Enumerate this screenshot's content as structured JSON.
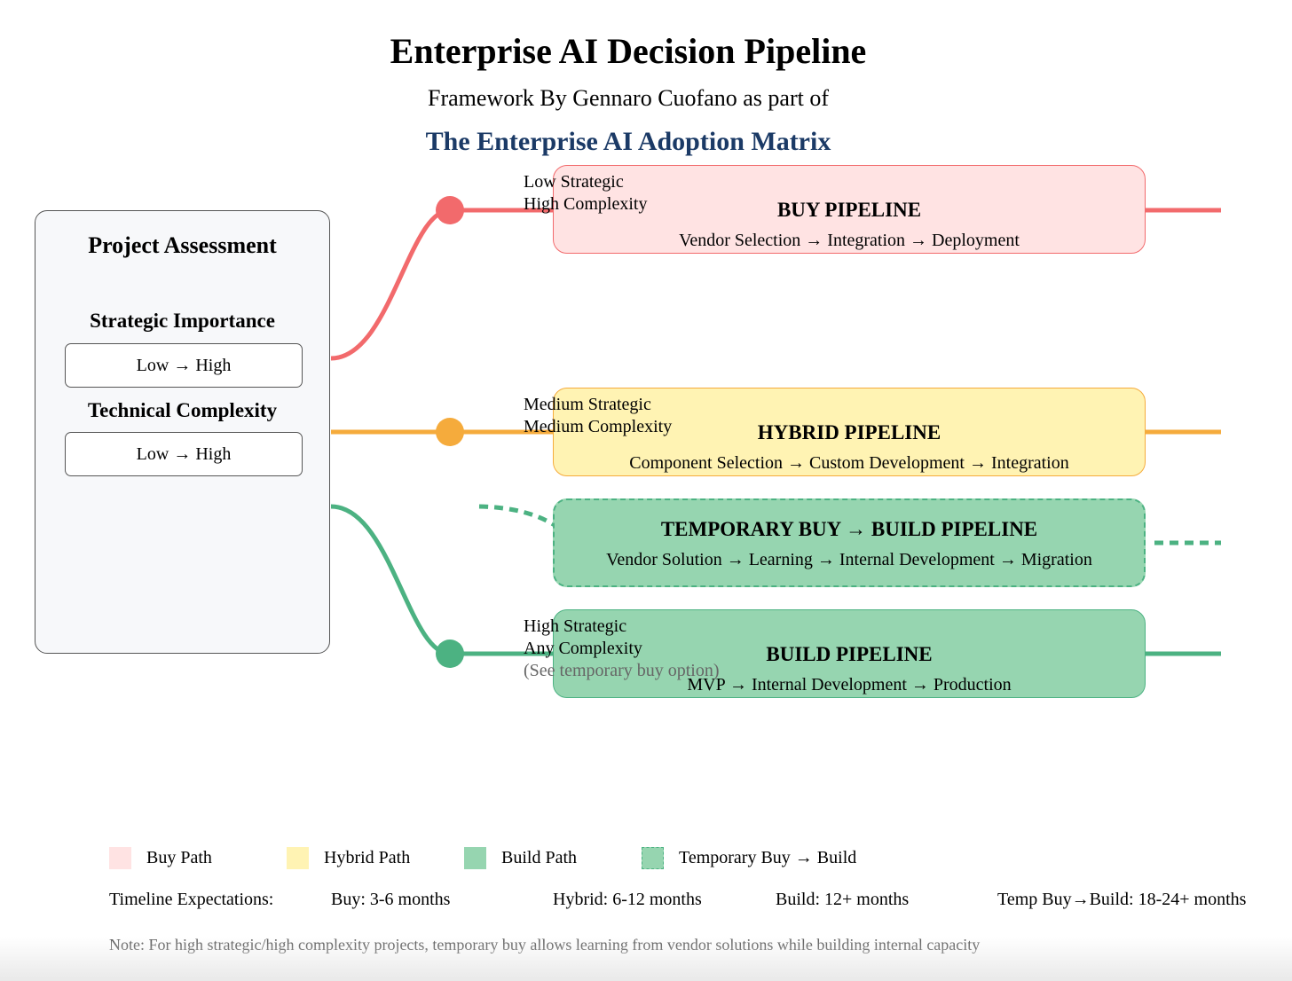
{
  "header": {
    "title": "Enterprise AI Decision Pipeline",
    "subtitle": "Framework By Gennaro Cuofano as part of",
    "matrix_title": "The Enterprise AI Adoption Matrix"
  },
  "colors": {
    "buy_line": "#f26a6c",
    "buy_fill": "#ffe3e3",
    "hybrid_line": "#f5ab3c",
    "hybrid_fill": "#fff3b3",
    "build_line": "#4cb282",
    "build_fill": "#96d5b0",
    "matrix_title": "#1b3a66"
  },
  "assessment": {
    "title": "Project Assessment",
    "factors": [
      {
        "label": "Strategic Importance",
        "scale": "Low → High"
      },
      {
        "label": "Technical Complexity",
        "scale": "Low → High"
      }
    ]
  },
  "pipelines": [
    {
      "id": "buy",
      "title": "BUY PIPELINE",
      "steps": "Vendor Selection → Integration → Deployment",
      "criteria": [
        "Low Strategic",
        "High Complexity"
      ]
    },
    {
      "id": "hybrid",
      "title": "HYBRID PIPELINE",
      "steps": "Component Selection → Custom Development → Integration",
      "criteria": [
        "Medium Strategic",
        "Medium Complexity"
      ]
    },
    {
      "id": "temp",
      "title": "TEMPORARY BUY → BUILD PIPELINE",
      "steps": "Vendor Solution → Learning → Internal Development → Migration",
      "criteria": []
    },
    {
      "id": "build",
      "title": "BUILD PIPELINE",
      "steps": "MVP → Internal Development → Production",
      "criteria": [
        "High Strategic",
        "Any Complexity"
      ],
      "criteria_note": "(See temporary buy option)"
    }
  ],
  "legend": [
    {
      "label": "Buy Path"
    },
    {
      "label": "Hybrid Path"
    },
    {
      "label": "Build Path"
    },
    {
      "label": "Temporary Buy → Build"
    }
  ],
  "timeline": {
    "label": "Timeline Expectations:",
    "items": [
      "Buy: 3-6 months",
      "Hybrid: 6-12 months",
      "Build: 12+ months",
      "Temp Buy→Build: 18-24+ months"
    ]
  },
  "footnote": "Note: For high strategic/high complexity projects, temporary buy allows learning from vendor solutions while building internal capacity"
}
